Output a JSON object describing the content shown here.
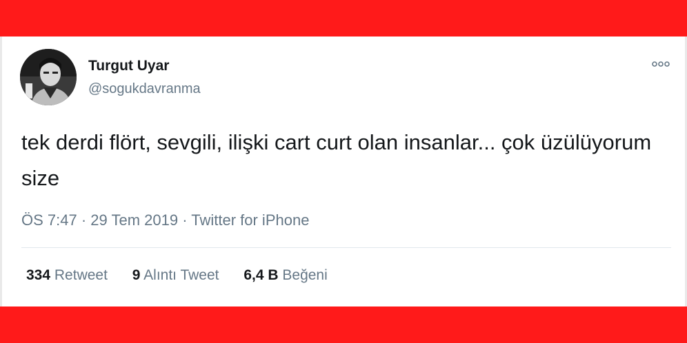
{
  "colors": {
    "banner_red": "#ff1a1a",
    "text_primary": "#14171a",
    "text_secondary": "#657786",
    "divider": "#e1e8ed"
  },
  "tweet": {
    "author": {
      "display_name": "Turgut Uyar",
      "handle": "@sogukdavranma",
      "avatar_icon": "profile-photo"
    },
    "more_icon": "more-options-icon",
    "text": "tek derdi flört, sevgili, ilişki cart curt olan insanlar... çok üzülüyorum size",
    "meta": {
      "time": "ÖS 7:47",
      "separator1": " · ",
      "date": "29 Tem 2019",
      "separator2": " · ",
      "source": "Twitter for iPhone"
    },
    "stats": {
      "retweets_count": "334",
      "retweets_label": "Retweet",
      "quotes_count": "9",
      "quotes_label": "Alıntı Tweet",
      "likes_count": "6,4 B",
      "likes_label": "Beğeni"
    }
  }
}
